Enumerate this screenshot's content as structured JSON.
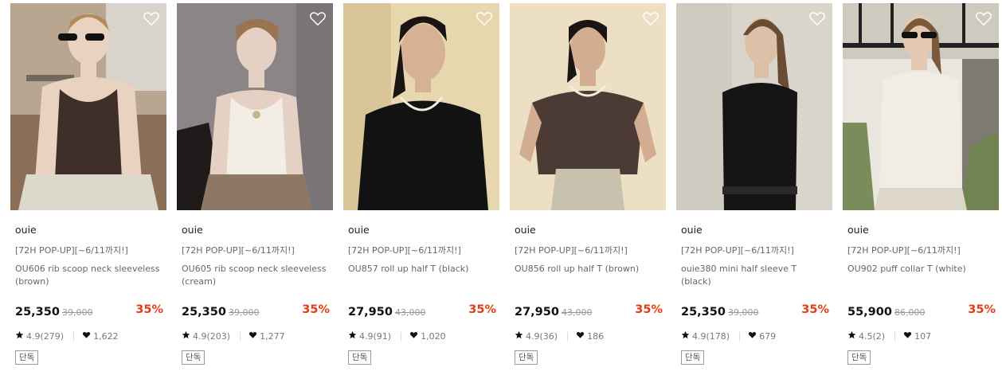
{
  "products": [
    {
      "brand": "ouie",
      "promo": "[72H POP-UP][~6/11까지!]",
      "name": "OU606 rib scoop neck sleeveless (brown)",
      "price": "25,350",
      "original_price": "39,000",
      "discount": "35%",
      "rating": "4.9(279)",
      "likes": "1,622",
      "badge": "단독"
    },
    {
      "brand": "ouie",
      "promo": "[72H POP-UP][~6/11까지!]",
      "name": "OU605 rib scoop neck sleeveless (cream)",
      "price": "25,350",
      "original_price": "39,000",
      "discount": "35%",
      "rating": "4.9(203)",
      "likes": "1,277",
      "badge": "단독"
    },
    {
      "brand": "ouie",
      "promo": "[72H POP-UP][~6/11까지!]",
      "name": "OU857 roll up half T (black)",
      "price": "27,950",
      "original_price": "43,000",
      "discount": "35%",
      "rating": "4.9(91)",
      "likes": "1,020",
      "badge": "단독"
    },
    {
      "brand": "ouie",
      "promo": "[72H POP-UP][~6/11까지!]",
      "name": "OU856 roll up half T (brown)",
      "price": "27,950",
      "original_price": "43,000",
      "discount": "35%",
      "rating": "4.9(36)",
      "likes": "186",
      "badge": "단독"
    },
    {
      "brand": "ouie",
      "promo": "[72H POP-UP][~6/11까지!]",
      "name": "ouie380 mini half sleeve T (black)",
      "price": "25,350",
      "original_price": "39,000",
      "discount": "35%",
      "rating": "4.9(178)",
      "likes": "679",
      "badge": "단독"
    },
    {
      "brand": "ouie",
      "promo": "[72H POP-UP][~6/11까지!]",
      "name": "OU902 puff collar T (white)",
      "price": "55,900",
      "original_price": "86,000",
      "discount": "35%",
      "rating": "4.5(2)",
      "likes": "107",
      "badge": "단독"
    }
  ],
  "icons": {
    "wishlist": "heart-outline-icon",
    "rating": "star-icon",
    "likes": "heart-filled-icon"
  },
  "colors": {
    "discount": "#e63b12",
    "price": "#111111",
    "muted_text": "#666666"
  }
}
